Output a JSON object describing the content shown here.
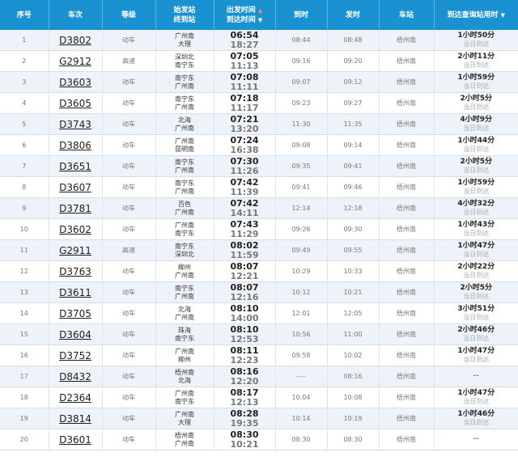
{
  "header": {
    "seq": "序号",
    "train": "车次",
    "grade": "等级",
    "origin_dest_l1": "始发站",
    "origin_dest_l2": "终到站",
    "dep_time_l1": "出发时间",
    "dep_time_l2": "到达时间",
    "arrive": "到时",
    "depart": "发时",
    "station": "车站",
    "query_arrival": "到达查询站用时",
    "sort_up_icon": "▲",
    "sort_down_icon": "▼"
  },
  "rows": [
    {
      "seq": "1",
      "train": "D3802",
      "type": "动车",
      "from": "广州南",
      "to": "大理",
      "dep": "06:54",
      "arr": "18:27",
      "arrive": "08:44",
      "depart": "08:48",
      "station": "梧州南",
      "duration": "1小时50分",
      "same_day": "当日到达"
    },
    {
      "seq": "2",
      "train": "G2912",
      "type": "高速",
      "from": "深圳北",
      "to": "南宁东",
      "dep": "07:05",
      "arr": "11:13",
      "arrive": "09:16",
      "depart": "09:20",
      "station": "梧州南",
      "duration": "2小时11分",
      "same_day": "当日到达"
    },
    {
      "seq": "3",
      "train": "D3603",
      "type": "动车",
      "from": "南宁东",
      "to": "广州南",
      "dep": "07:08",
      "arr": "11:11",
      "arrive": "09:07",
      "depart": "09:12",
      "station": "梧州南",
      "duration": "1小时59分",
      "same_day": "当日到达"
    },
    {
      "seq": "4",
      "train": "D3605",
      "type": "动车",
      "from": "南宁东",
      "to": "广州南",
      "dep": "07:18",
      "arr": "11:17",
      "arrive": "09:23",
      "depart": "09:27",
      "station": "梧州南",
      "duration": "2小时5分",
      "same_day": "当日到达"
    },
    {
      "seq": "5",
      "train": "D3743",
      "type": "动车",
      "from": "北海",
      "to": "广州南",
      "dep": "07:21",
      "arr": "13:20",
      "arrive": "11:30",
      "depart": "11:35",
      "station": "梧州南",
      "duration": "4小时9分",
      "same_day": "当日到达"
    },
    {
      "seq": "6",
      "train": "D3806",
      "type": "动车",
      "from": "广州南",
      "to": "昆明南",
      "dep": "07:24",
      "arr": "16:38",
      "arrive": "09:08",
      "depart": "09:14",
      "station": "梧州南",
      "duration": "1小时44分",
      "same_day": "当日到达"
    },
    {
      "seq": "7",
      "train": "D3651",
      "type": "动车",
      "from": "南宁东",
      "to": "广州南",
      "dep": "07:30",
      "arr": "11:26",
      "arrive": "09:35",
      "depart": "09:41",
      "station": "梧州南",
      "duration": "2小时5分",
      "same_day": "当日到达"
    },
    {
      "seq": "8",
      "train": "D3607",
      "type": "动车",
      "from": "南宁东",
      "to": "广州南",
      "dep": "07:42",
      "arr": "11:39",
      "arrive": "09:41",
      "depart": "09:46",
      "station": "梧州南",
      "duration": "1小时59分",
      "same_day": "当日到达"
    },
    {
      "seq": "9",
      "train": "D3781",
      "type": "动车",
      "from": "百色",
      "to": "广州南",
      "dep": "07:42",
      "arr": "14:11",
      "arrive": "12:14",
      "depart": "12:18",
      "station": "梧州南",
      "duration": "4小时32分",
      "same_day": "当日到达"
    },
    {
      "seq": "10",
      "train": "D3602",
      "type": "动车",
      "from": "广州南",
      "to": "南宁东",
      "dep": "07:43",
      "arr": "11:29",
      "arrive": "09:26",
      "depart": "09:30",
      "station": "梧州南",
      "duration": "1小时43分",
      "same_day": "当日到达"
    },
    {
      "seq": "11",
      "train": "G2911",
      "type": "高速",
      "from": "南宁东",
      "to": "深圳北",
      "dep": "08:02",
      "arr": "11:59",
      "arrive": "09:49",
      "depart": "09:55",
      "station": "梧州南",
      "duration": "1小时47分",
      "same_day": "当日到达"
    },
    {
      "seq": "12",
      "train": "D3763",
      "type": "动车",
      "from": "柳州",
      "to": "广州南",
      "dep": "08:07",
      "arr": "12:21",
      "arrive": "10:29",
      "depart": "10:33",
      "station": "梧州南",
      "duration": "2小时22分",
      "same_day": "当日到达"
    },
    {
      "seq": "13",
      "train": "D3611",
      "type": "动车",
      "from": "南宁东",
      "to": "广州南",
      "dep": "08:07",
      "arr": "12:16",
      "arrive": "10:12",
      "depart": "10:21",
      "station": "梧州南",
      "duration": "2小时5分",
      "same_day": "当日到达"
    },
    {
      "seq": "14",
      "train": "D3705",
      "type": "动车",
      "from": "北海",
      "to": "广州南",
      "dep": "08:10",
      "arr": "14:00",
      "arrive": "12:01",
      "depart": "12:05",
      "station": "梧州南",
      "duration": "3小时51分",
      "same_day": "当日到达"
    },
    {
      "seq": "15",
      "train": "D3604",
      "type": "动车",
      "from": "珠海",
      "to": "南宁东",
      "dep": "08:10",
      "arr": "12:53",
      "arrive": "10:56",
      "depart": "11:00",
      "station": "梧州南",
      "duration": "2小时46分",
      "same_day": "当日到达"
    },
    {
      "seq": "16",
      "train": "D3752",
      "type": "动车",
      "from": "广州南",
      "to": "柳州",
      "dep": "08:11",
      "arr": "12:23",
      "arrive": "09:58",
      "depart": "10:02",
      "station": "梧州南",
      "duration": "1小时47分",
      "same_day": "当日到达"
    },
    {
      "seq": "17",
      "train": "D8432",
      "type": "动车",
      "from": "梧州南",
      "to": "北海",
      "dep": "08:16",
      "arr": "12:20",
      "arrive": "----",
      "depart": "08:16",
      "station": "梧州南",
      "duration": "--",
      "same_day": ""
    },
    {
      "seq": "18",
      "train": "D2364",
      "type": "动车",
      "from": "广州南",
      "to": "南宁东",
      "dep": "08:17",
      "arr": "12:13",
      "arrive": "10:04",
      "depart": "10:08",
      "station": "梧州南",
      "duration": "1小时47分",
      "same_day": "当日到达"
    },
    {
      "seq": "19",
      "train": "D3814",
      "type": "动车",
      "from": "广州南",
      "to": "大理",
      "dep": "08:28",
      "arr": "19:35",
      "arrive": "10:14",
      "depart": "10:19",
      "station": "梧州南",
      "duration": "1小时46分",
      "same_day": "当日到达"
    },
    {
      "seq": "20",
      "train": "D3601",
      "type": "动车",
      "from": "梧州南",
      "to": "广州南",
      "dep": "08:30",
      "arr": "10:21",
      "arrive": "08:30",
      "depart": "08:30",
      "station": "梧州南",
      "duration": "--",
      "same_day": ""
    }
  ]
}
